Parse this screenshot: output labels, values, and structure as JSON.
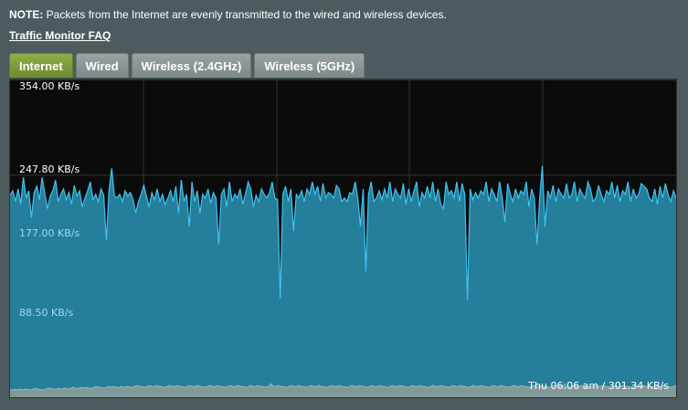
{
  "note": {
    "label": "NOTE:",
    "text": " Packets from the Internet are evenly transmitted to the wired and wireless devices."
  },
  "faq_link": "Traffic Monitor FAQ",
  "tabs": [
    {
      "label": "Internet",
      "active": true
    },
    {
      "label": "Wired",
      "active": false
    },
    {
      "label": "Wireless (2.4GHz)",
      "active": false
    },
    {
      "label": "Wireless (5GHz)",
      "active": false
    }
  ],
  "graph": {
    "y_labels": [
      "354.00 KB/s",
      "247.80 KB/s",
      "177.00 KB/s",
      "88.50 KB/s"
    ],
    "status": "Thu 06:06 am / 301.34 KB/s",
    "colors": {
      "background": "#0b0b0b",
      "fill": "#257e9a",
      "line": "#3ec4f2",
      "baseline_fill": "#7f9a99",
      "grid": "#333333"
    }
  },
  "chart_data": {
    "type": "area",
    "ylim": [
      0,
      354
    ],
    "y_ticks": [
      354,
      247.8,
      177,
      88.5
    ],
    "series": [
      {
        "values": [
          225,
          230,
          218,
          232,
          215,
          245,
          222,
          230,
          200,
          228,
          235,
          220,
          245,
          226,
          210,
          224,
          230,
          242,
          218,
          226,
          232,
          220,
          228,
          215,
          236,
          224,
          230,
          212,
          222,
          230,
          240,
          220,
          226,
          218,
          232,
          225,
          175,
          230,
          255,
          224,
          222,
          226,
          218,
          230,
          224,
          228,
          220,
          205,
          218,
          226,
          236,
          224,
          212,
          228,
          220,
          232,
          218,
          226,
          214,
          222,
          230,
          218,
          235,
          205,
          242,
          218,
          226,
          190,
          240,
          218,
          230,
          205,
          226,
          222,
          232,
          216,
          228,
          222,
          170,
          226,
          232,
          212,
          240,
          218,
          226,
          222,
          232,
          215,
          226,
          240,
          232,
          212,
          225,
          218,
          232,
          226,
          222,
          228,
          240,
          222,
          220,
          110,
          226,
          235,
          218,
          232,
          185,
          226,
          222,
          230,
          218,
          232,
          226,
          240,
          226,
          235,
          218,
          238,
          222,
          228,
          226,
          222,
          236,
          232,
          218,
          222,
          218,
          228,
          226,
          240,
          222,
          190,
          232,
          140,
          226,
          240,
          218,
          222,
          230,
          220,
          232,
          222,
          240,
          218,
          232,
          226,
          222,
          238,
          215,
          232,
          218,
          230,
          240,
          212,
          228,
          222,
          235,
          222,
          240,
          218,
          232,
          215,
          210,
          240,
          226,
          230,
          222,
          240,
          218,
          238,
          226,
          108,
          232,
          220,
          228,
          222,
          230,
          226,
          240,
          218,
          232,
          226,
          218,
          240,
          222,
          195,
          238,
          226,
          218,
          232,
          222,
          230,
          226,
          240,
          212,
          232,
          222,
          170,
          222,
          258,
          190,
          230,
          222,
          236,
          218,
          232,
          226,
          222,
          238,
          222,
          226,
          240,
          218,
          232,
          226,
          222,
          240,
          232,
          218,
          222,
          236,
          226,
          218,
          230,
          226,
          240,
          222,
          236,
          218,
          230,
          226,
          240,
          218,
          232,
          222,
          226,
          238,
          235,
          232,
          222,
          218,
          232,
          215,
          235,
          222,
          238,
          226,
          218,
          230,
          222
        ]
      },
      {
        "values": [
          8,
          8,
          9,
          8,
          9,
          8,
          9,
          9,
          8,
          9,
          10,
          9,
          9,
          8,
          9,
          10,
          10,
          9,
          9,
          10,
          9,
          10,
          10,
          9,
          10,
          11,
          10,
          10,
          11,
          10,
          11,
          10,
          10,
          11,
          12,
          11,
          11,
          10,
          11,
          12,
          11,
          12,
          11,
          11,
          12,
          11,
          12,
          12,
          11,
          12,
          13,
          12,
          12,
          11,
          12,
          13,
          12,
          12,
          13,
          12,
          12,
          11,
          12,
          13,
          12,
          12,
          13,
          12,
          12,
          11,
          12,
          13,
          12,
          12,
          13,
          12,
          12,
          11,
          12,
          13,
          12,
          12,
          13,
          12,
          12,
          11,
          12,
          13,
          12,
          12,
          13,
          12,
          12,
          11,
          12,
          13,
          12,
          12,
          13,
          12,
          12,
          11,
          12,
          15,
          12,
          12,
          13,
          12,
          12,
          11,
          12,
          13,
          12,
          12,
          13,
          12,
          12,
          11,
          12,
          13,
          12,
          12,
          13,
          12,
          12,
          11,
          12,
          13,
          12,
          12,
          13,
          12,
          12,
          11,
          12,
          13,
          12,
          12,
          13,
          12,
          12,
          11,
          12,
          13,
          12,
          12,
          13,
          12,
          12,
          11,
          12,
          13,
          12,
          12,
          13,
          12,
          12,
          11,
          12,
          13,
          12,
          12,
          13,
          12,
          12,
          11,
          12,
          13,
          12,
          12,
          13,
          12,
          12,
          11,
          12,
          13,
          12,
          12,
          13,
          12,
          12,
          11,
          12,
          13,
          12,
          12,
          13,
          12,
          12,
          11,
          12,
          13,
          12,
          12,
          13,
          12,
          12,
          11,
          12,
          13,
          12,
          12,
          13,
          12,
          12,
          11,
          12,
          13,
          12,
          12,
          13,
          12,
          12,
          11,
          12,
          13,
          12,
          12,
          13,
          12,
          12,
          11,
          12,
          13,
          12,
          12,
          13,
          12,
          12,
          11,
          12,
          13,
          12,
          12,
          13,
          12,
          12,
          11,
          12,
          13,
          12,
          12,
          13,
          12,
          12,
          11,
          12,
          13,
          12,
          12,
          13,
          12,
          12,
          11,
          12,
          13,
          12,
          12,
          13,
          12,
          12,
          11,
          12,
          13
        ]
      }
    ]
  }
}
